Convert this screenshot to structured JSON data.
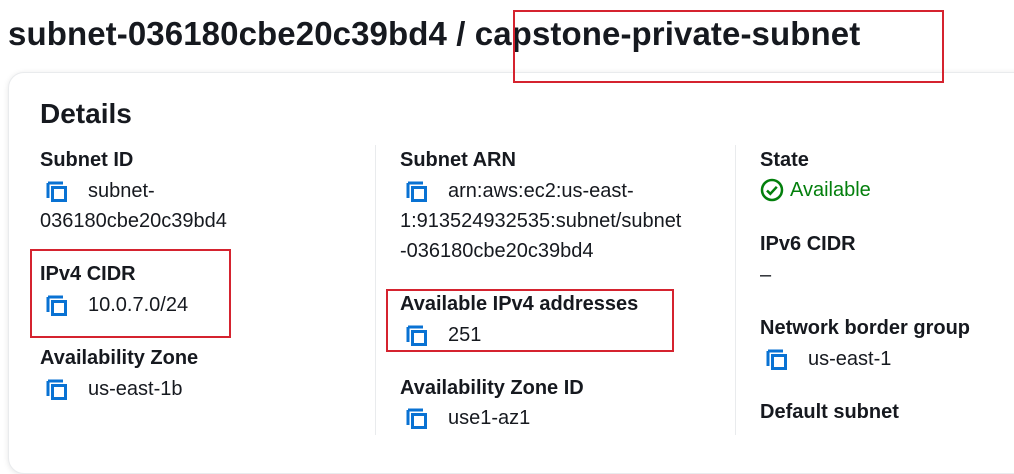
{
  "page": {
    "title": "subnet-036180cbe20c39bd4 / capstone-private-subnet"
  },
  "details": {
    "heading": "Details",
    "subnet_id": {
      "label": "Subnet ID",
      "value_line1": "subnet-",
      "value_line2": "036180cbe20c39bd4"
    },
    "ipv4_cidr": {
      "label": "IPv4 CIDR",
      "value": "10.0.7.0/24"
    },
    "availability_zone": {
      "label": "Availability Zone",
      "value": "us-east-1b"
    },
    "subnet_arn": {
      "label": "Subnet ARN",
      "value_line1": "arn:aws:ec2:us-east-",
      "value_line2": "1:913524932535:subnet/subnet",
      "value_line3": "-036180cbe20c39bd4"
    },
    "available_ipv4": {
      "label": "Available IPv4 addresses",
      "value": "251"
    },
    "availability_zone_id": {
      "label": "Availability Zone ID",
      "value": "use1-az1"
    },
    "state": {
      "label": "State",
      "value": "Available"
    },
    "ipv6_cidr": {
      "label": "IPv6 CIDR",
      "value": "–"
    },
    "network_border_group": {
      "label": "Network border group",
      "value": "us-east-1"
    },
    "default_subnet": {
      "label": "Default subnet"
    }
  },
  "colors": {
    "accent": "#0972d3",
    "success": "#037f0c",
    "highlight": "#d5232f"
  },
  "icons": {
    "copy": "copy-icon",
    "status": "check-circle-icon"
  }
}
